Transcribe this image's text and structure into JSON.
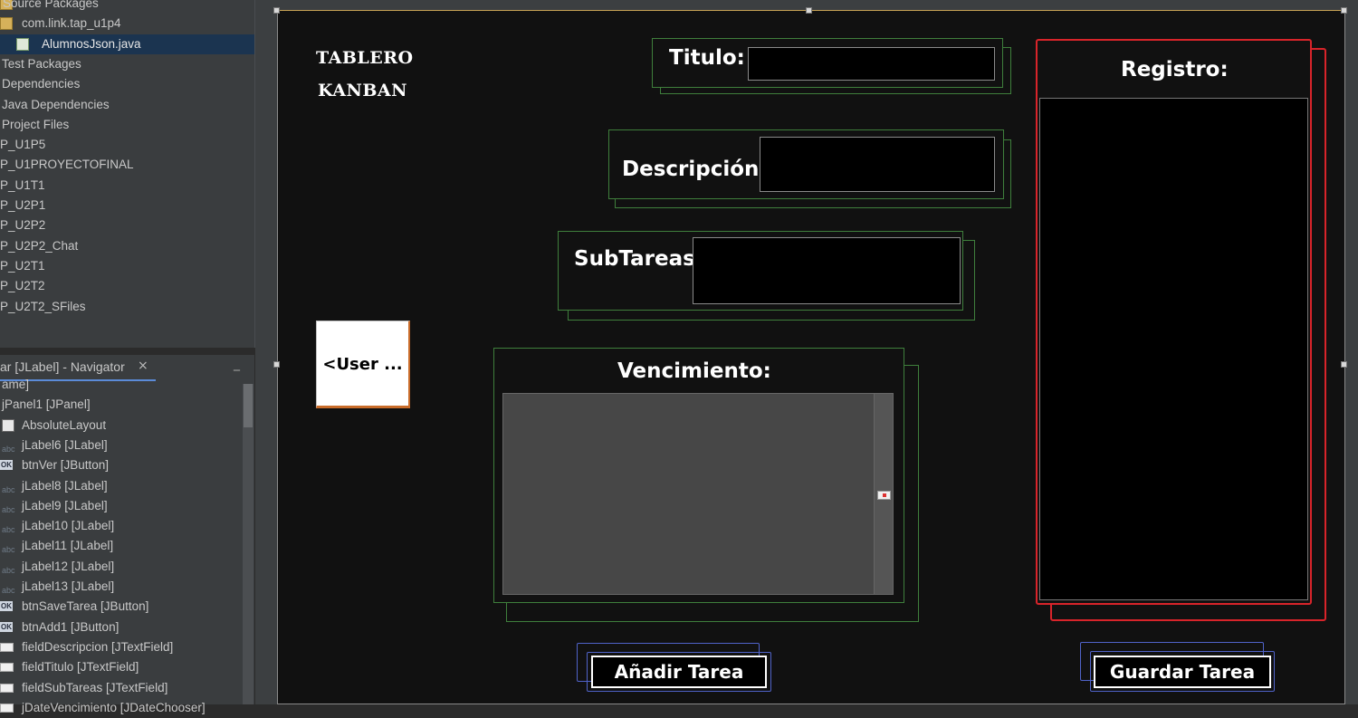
{
  "projects": {
    "items": [
      {
        "label": "Source Packages",
        "icon": "source-packages-icon"
      },
      {
        "label": "com.link.tap_u1p4",
        "icon": "package-icon"
      },
      {
        "label": "AlumnosJson.java",
        "icon": "java-file-icon",
        "selected": true
      },
      {
        "label": "Test Packages",
        "icon": ""
      },
      {
        "label": "Dependencies",
        "icon": ""
      },
      {
        "label": "Java Dependencies",
        "icon": ""
      },
      {
        "label": "Project Files",
        "icon": ""
      },
      {
        "label": "P_U1P5",
        "icon": ""
      },
      {
        "label": "P_U1PROYECTOFINAL",
        "icon": ""
      },
      {
        "label": "P_U1T1",
        "icon": ""
      },
      {
        "label": "P_U2P1",
        "icon": ""
      },
      {
        "label": "P_U2P2",
        "icon": ""
      },
      {
        "label": "P_U2P2_Chat",
        "icon": ""
      },
      {
        "label": "P_U2T1",
        "icon": ""
      },
      {
        "label": "P_U2T2",
        "icon": ""
      },
      {
        "label": "P_U2T2_SFiles",
        "icon": ""
      }
    ]
  },
  "navigator": {
    "tab_title": "ar [JLabel] - Navigator",
    "close_glyph": "×",
    "minimize_glyph": "_",
    "items": [
      {
        "label": "ame]",
        "kind": "none"
      },
      {
        "label": "jPanel1 [JPanel]",
        "kind": "none"
      },
      {
        "label": "AbsoluteLayout",
        "kind": "layout"
      },
      {
        "label": "jLabel6 [JLabel]",
        "kind": "label"
      },
      {
        "label": "btnVer [JButton]",
        "kind": "button"
      },
      {
        "label": "jLabel8 [JLabel]",
        "kind": "label"
      },
      {
        "label": "jLabel9 [JLabel]",
        "kind": "label"
      },
      {
        "label": "jLabel10 [JLabel]",
        "kind": "label"
      },
      {
        "label": "jLabel11 [JLabel]",
        "kind": "label"
      },
      {
        "label": "jLabel12 [JLabel]",
        "kind": "label"
      },
      {
        "label": "jLabel13 [JLabel]",
        "kind": "label"
      },
      {
        "label": "btnSaveTarea [JButton]",
        "kind": "button"
      },
      {
        "label": "btnAdd1 [JButton]",
        "kind": "button"
      },
      {
        "label": "fieldDescripcion [JTextField]",
        "kind": "textfield"
      },
      {
        "label": "fieldTitulo [JTextField]",
        "kind": "textfield"
      },
      {
        "label": "fieldSubTareas [JTextField]",
        "kind": "textfield"
      },
      {
        "label": "jDateVencimiento [JDateChooser]",
        "kind": "textfield"
      }
    ]
  },
  "form": {
    "title_line1": "TABLERO",
    "title_line2": "KANBAN",
    "user_button": "<User ...",
    "titulo_label": "Titulo:",
    "descripcion_label": "Descripción:",
    "subtareas_label": "SubTareas:",
    "vencimiento_label": "Vencimiento:",
    "registro_label": "Registro:",
    "add_button": "Añadir Tarea",
    "save_button": "Guardar Tarea"
  },
  "colors": {
    "panel_bg": "#111111",
    "green_border": "#3f7f3c",
    "red_border": "#d8242a",
    "blue_border": "#5063c9",
    "user_button_accent": "#c96c2a"
  }
}
